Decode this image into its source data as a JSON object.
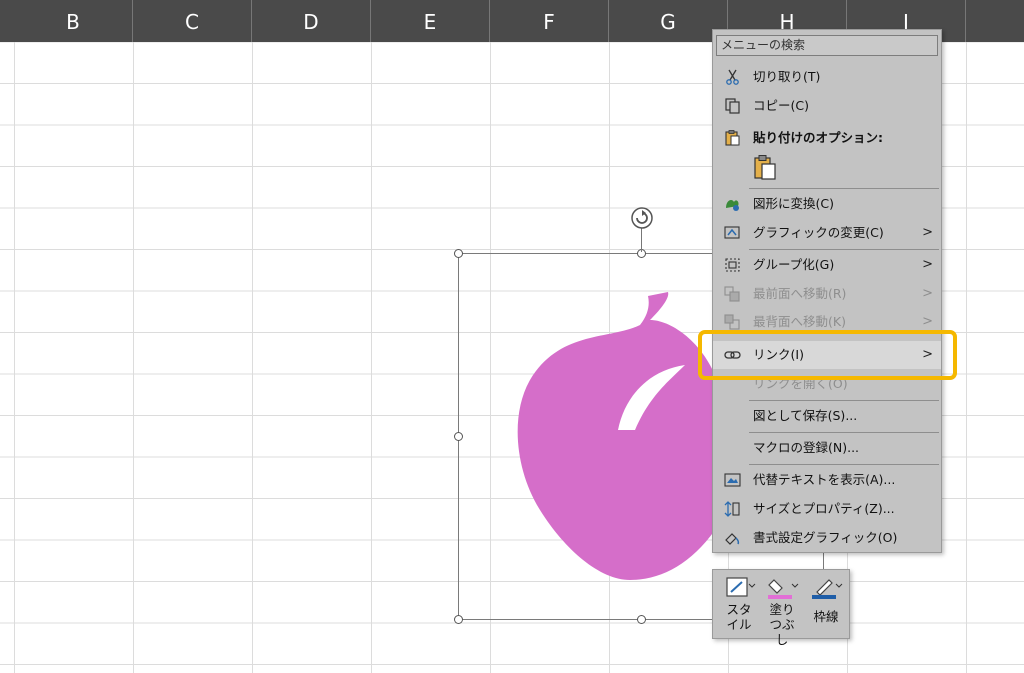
{
  "columns": [
    "B",
    "C",
    "D",
    "E",
    "F",
    "G",
    "H",
    "I"
  ],
  "shape": {
    "name": "peach",
    "fill_color": "#d56ec9"
  },
  "context_menu": {
    "search_placeholder": "メニューの検索",
    "items": [
      {
        "label": "切り取り(T)",
        "icon": "scissors-icon",
        "enabled": true
      },
      {
        "label": "コピー(C)",
        "icon": "copy-icon",
        "enabled": true
      },
      {
        "label": "貼り付けのオプション:",
        "icon": "paste-icon",
        "enabled": true
      },
      {
        "label": "図形に変換(C)",
        "icon": "convert-to-shape-icon",
        "enabled": true
      },
      {
        "label": "グラフィックの変更(C)",
        "icon": "change-graphic-icon",
        "enabled": true,
        "submenu": true
      },
      {
        "label": "グループ化(G)",
        "icon": "group-icon",
        "enabled": true,
        "submenu": true
      },
      {
        "label": "最前面へ移動(R)",
        "icon": "bring-to-front-icon",
        "enabled": false,
        "submenu": true
      },
      {
        "label": "最背面へ移動(K)",
        "icon": "send-to-back-icon",
        "enabled": false,
        "submenu": true
      },
      {
        "label": "リンク(I)",
        "icon": "link-icon",
        "enabled": true,
        "submenu": true,
        "highlighted": true
      },
      {
        "label": "リンクを開く(O)",
        "icon": "open-link-icon",
        "enabled": false
      },
      {
        "label": "図として保存(S)...",
        "icon": "",
        "enabled": true
      },
      {
        "label": "マクロの登録(N)...",
        "icon": "",
        "enabled": true
      },
      {
        "label": "代替テキストを表示(A)...",
        "icon": "alt-text-icon",
        "enabled": true
      },
      {
        "label": "サイズとプロパティ(Z)...",
        "icon": "size-properties-icon",
        "enabled": true
      },
      {
        "label": "書式設定グラフィック(O)",
        "icon": "format-graphic-icon",
        "enabled": true
      }
    ],
    "submenu_arrow": ">"
  },
  "mini_toolbar": {
    "style_label": "スタイル",
    "fill_label": "塗りつぶし",
    "outline_label": "枠線",
    "fill_color": "#e26fd6",
    "outline_color": "#1f5ea8"
  },
  "highlight_color": "#f5b800"
}
